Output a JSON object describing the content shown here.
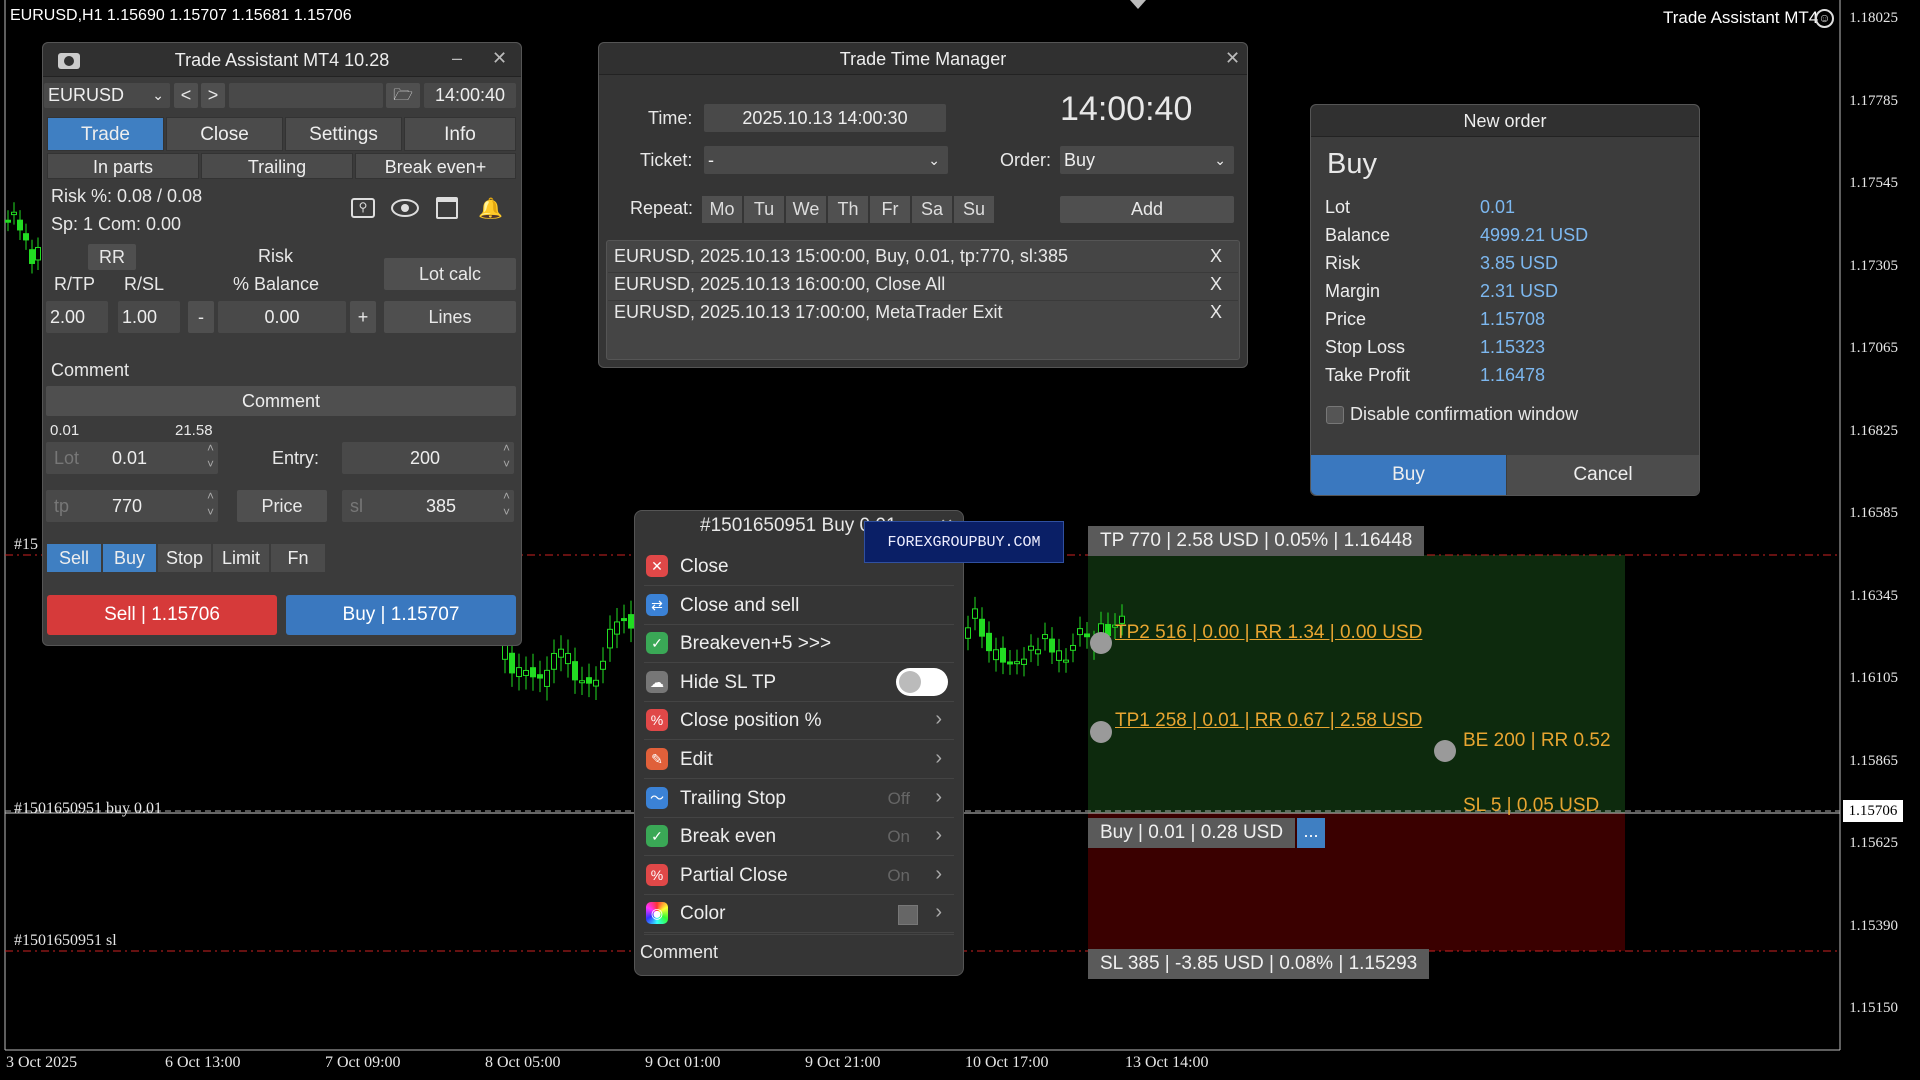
{
  "chart": {
    "header": "EURUSD,H1  1.15690 1.15707 1.15681 1.15706",
    "product": "Trade Assistant MT4",
    "price_levels": [
      "1.18025",
      "1.17785",
      "1.17545",
      "1.17305",
      "1.17065",
      "1.16825",
      "1.16585",
      "1.16345",
      "1.16105",
      "1.15865",
      "1.15625",
      "1.15390",
      "1.15150"
    ],
    "current_price": "1.15706",
    "time_labels": [
      "3 Oct 2025",
      "6 Oct 13:00",
      "7 Oct 09:00",
      "8 Oct 05:00",
      "9 Oct 01:00",
      "9 Oct 21:00",
      "10 Oct 17:00",
      "13 Oct 14:00"
    ],
    "buy_line_label": "#1501650951 buy 0.01",
    "sl_line_label": "#1501650951 sl",
    "tp_line_label": "#15",
    "colors": {
      "bull": "#22dd22",
      "bear": "#22dd22",
      "tp_zone": "#0d2a0d",
      "sl_zone": "#3a0000",
      "level_line": "#cc2222"
    }
  },
  "trade_assistant": {
    "title": "Trade Assistant MT4 10.28",
    "symbol": "EURUSD",
    "time": "14:00:40",
    "tabs": [
      "Trade",
      "Close",
      "Settings",
      "Info"
    ],
    "subtabs": [
      "In parts",
      "Trailing",
      "Break even+"
    ],
    "risk_text": "Risk %: 0.08 /  0.08",
    "spread_text": "Sp: 1  Com: 0.00",
    "rr_button": "RR",
    "risk_label": "Risk",
    "balance_label": "% Balance",
    "rtp_label": "R/TP",
    "rsl_label": "R/SL",
    "rtp_value": "2.00",
    "rsl_value": "1.00",
    "minus": "-",
    "plus": "+",
    "risk_value": "0.00",
    "lotcalc_button": "Lot calc",
    "lines_button": "Lines",
    "comment_label": "Comment",
    "comment_field": "Comment",
    "lot_min": "0.01",
    "lot_max": "21.58",
    "lot_label": "Lot",
    "lot_value": "0.01",
    "entry_label": "Entry:",
    "entry_value": "200",
    "tp_label": "tp",
    "tp_value": "770",
    "price_button": "Price",
    "sl_label": "sl",
    "sl_value": "385",
    "order_types": [
      "Sell",
      "Buy",
      "Stop",
      "Limit",
      "Fn"
    ],
    "sell_button": "Sell  | 1.15706",
    "buy_button": "Buy  | 1.15707"
  },
  "time_manager": {
    "title": "Trade Time Manager",
    "time_label": "Time:",
    "time_value": "2025.10.13 14:00:30",
    "clock": "14:00:40",
    "ticket_label": "Ticket:",
    "ticket_value": "-",
    "order_label": "Order:",
    "order_value": "Buy",
    "repeat_label": "Repeat:",
    "days": [
      "Mo",
      "Tu",
      "We",
      "Th",
      "Fr",
      "Sa",
      "Su"
    ],
    "add_button": "Add",
    "tasks": [
      "EURUSD, 2025.10.13 15:00:00, Buy, 0.01, tp:770, sl:385",
      "EURUSD, 2025.10.13 16:00:00, Close All",
      "EURUSD, 2025.10.13 17:00:00, MetaTrader Exit"
    ],
    "remove": "X"
  },
  "new_order": {
    "title": "New order",
    "heading": "Buy",
    "rows": [
      {
        "label": "Lot",
        "value": "0.01"
      },
      {
        "label": "Balance",
        "value": "4999.21 USD"
      },
      {
        "label": "Risk",
        "value": "3.85 USD"
      },
      {
        "label": "Margin",
        "value": "2.31 USD"
      },
      {
        "label": "Price",
        "value": "1.15708"
      },
      {
        "label": "Stop Loss",
        "value": "1.15323"
      },
      {
        "label": "Take Profit",
        "value": "1.16478"
      }
    ],
    "disable_confirm": "Disable confirmation window",
    "buy_button": "Buy",
    "cancel_button": "Cancel"
  },
  "context_menu": {
    "title": "#1501650951 Buy 0.01",
    "watermark": "FOREXGROUPBUY.COM",
    "items": [
      {
        "label": "Close",
        "icon": "close-icon",
        "color": "#e04848",
        "status": "",
        "arrow": ""
      },
      {
        "label": "Close and sell",
        "icon": "swap-icon",
        "color": "#3b82d6",
        "status": "",
        "arrow": ""
      },
      {
        "label": "Breakeven+5 >>>",
        "icon": "shield-icon",
        "color": "#3aa856",
        "status": "",
        "arrow": ""
      },
      {
        "label": "Hide SL TP",
        "icon": "cloud-icon",
        "color": "#777777",
        "status": "",
        "arrow": ""
      },
      {
        "label": "Close position %",
        "icon": "percent-icon",
        "color": "#e04848",
        "status": "",
        "arrow": ">"
      },
      {
        "label": "Edit",
        "icon": "wrench-icon",
        "color": "#e0603a",
        "status": "",
        "arrow": ">"
      },
      {
        "label": "Trailing Stop",
        "icon": "trend-icon",
        "color": "#3b82d6",
        "status": "Off",
        "arrow": ">"
      },
      {
        "label": "Break even",
        "icon": "shield-icon",
        "color": "#3aa856",
        "status": "On",
        "arrow": ">"
      },
      {
        "label": "Partial Close",
        "icon": "percent-icon",
        "color": "#e04848",
        "status": "On",
        "arrow": ">"
      },
      {
        "label": "Color",
        "icon": "palette-icon",
        "color": "#c040c0",
        "status": "",
        "arrow": ">"
      }
    ],
    "comment": "Comment"
  },
  "position": {
    "tp_label": "TP 770 | 2.58 USD | 0.05% | 1.16448",
    "tp2_label": "TP2 516 | 0.00 | RR 1.34 | 0.00 USD",
    "tp1_label": "TP1 258 | 0.01 | RR 0.67 | 2.58 USD",
    "be_label": "BE 200 | RR 0.52",
    "sl5_label": "SL 5 | 0.05 USD",
    "buy_label": "Buy | 0.01 | 0.28 USD",
    "more_button": "...",
    "sl_label": "SL 385 | -3.85 USD | 0.08% | 1.15293"
  }
}
